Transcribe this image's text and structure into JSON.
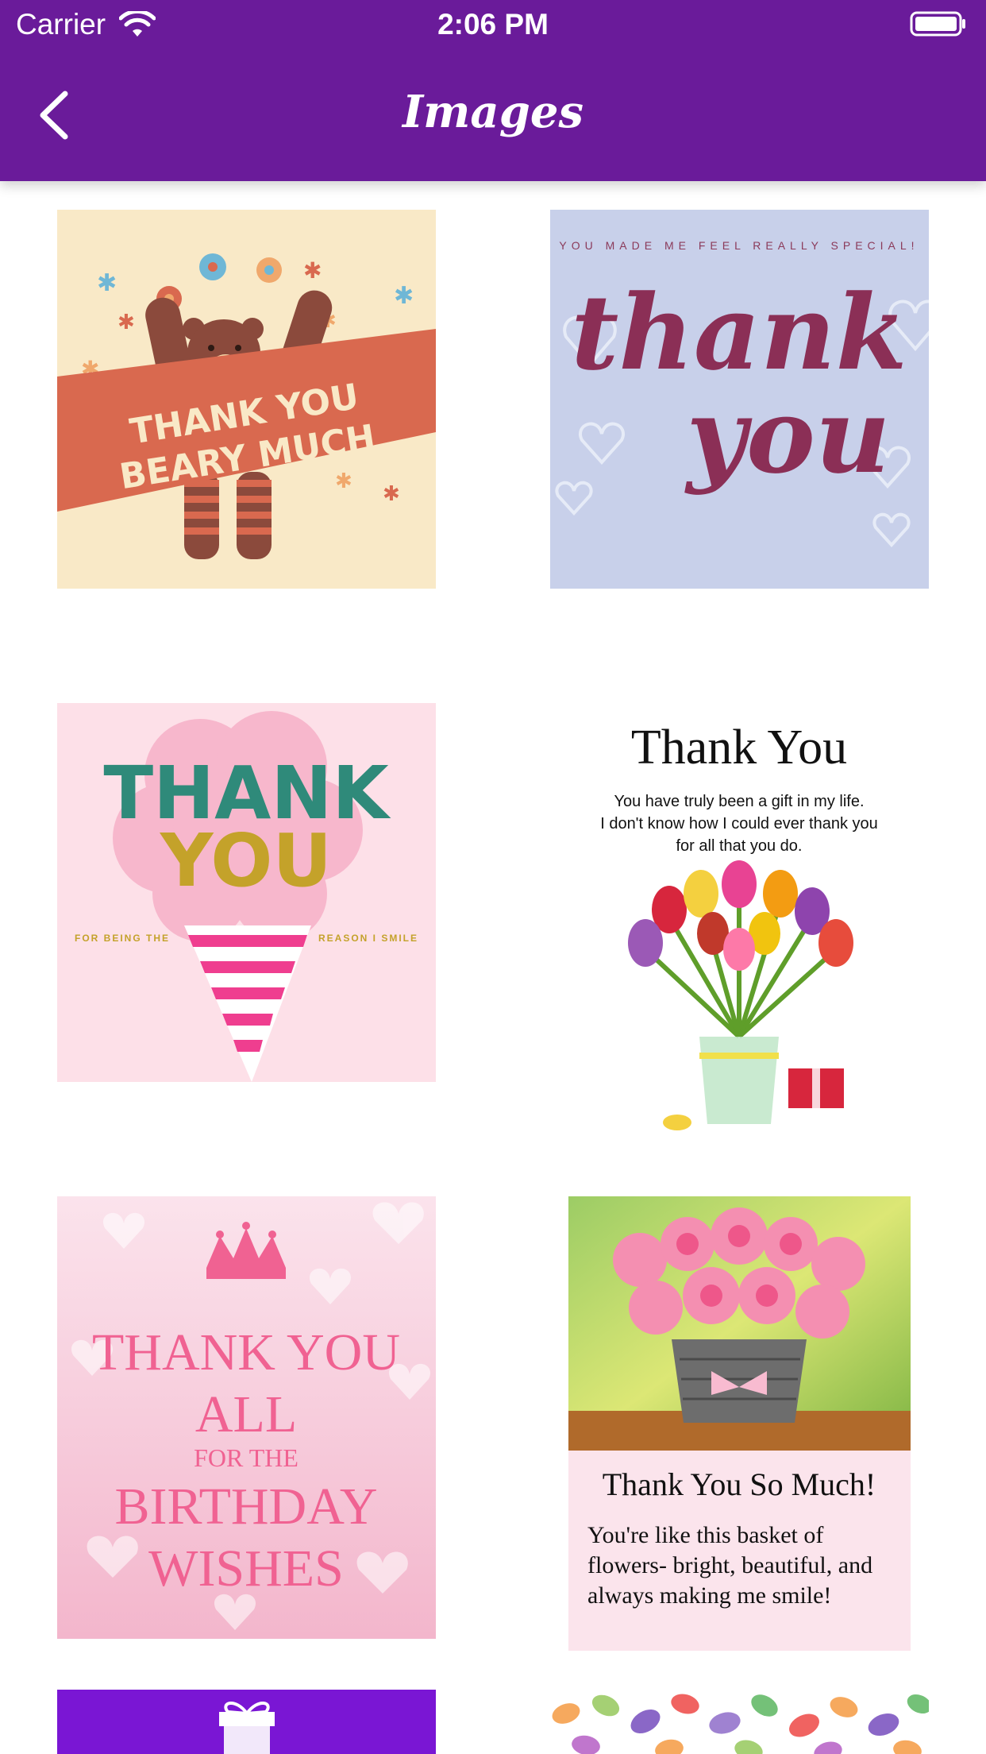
{
  "status_bar": {
    "carrier": "Carrier",
    "time": "2:06 PM"
  },
  "nav": {
    "title": "Images",
    "back_icon": "chevron-left-icon"
  },
  "colors": {
    "nav_bg": "#6a1b9a",
    "nav_text": "#ffffff",
    "background": "#ffffff"
  },
  "cards": [
    {
      "line1": "THANK YOU",
      "line2": "BEARY MUCH"
    },
    {
      "tagline": "YOU MADE ME FEEL REALLY SPECIAL!",
      "line1": "thank",
      "line2": "you"
    },
    {
      "line1": "THANK",
      "line2": "YOU",
      "left_caption": "FOR BEING THE",
      "right_caption": "REASON I SMILE"
    },
    {
      "title": "Thank You",
      "line1": "You have truly been a gift in my life.",
      "line2": "I don't know how I could ever thank you",
      "line3": "for all that you do."
    },
    {
      "line1": "THANK YOU",
      "line2": "ALL",
      "line3": "FOR THE",
      "line4": "BIRTHDAY",
      "line5": "WISHES"
    },
    {
      "title": "Thank You So Much!",
      "line1": "You're like this basket of",
      "line2": "flowers- bright, beautiful, and",
      "line3": "always making me smile!"
    },
    {
      "icon": "gift-icon"
    },
    {
      "pattern": "leaves-pattern-icon"
    }
  ]
}
